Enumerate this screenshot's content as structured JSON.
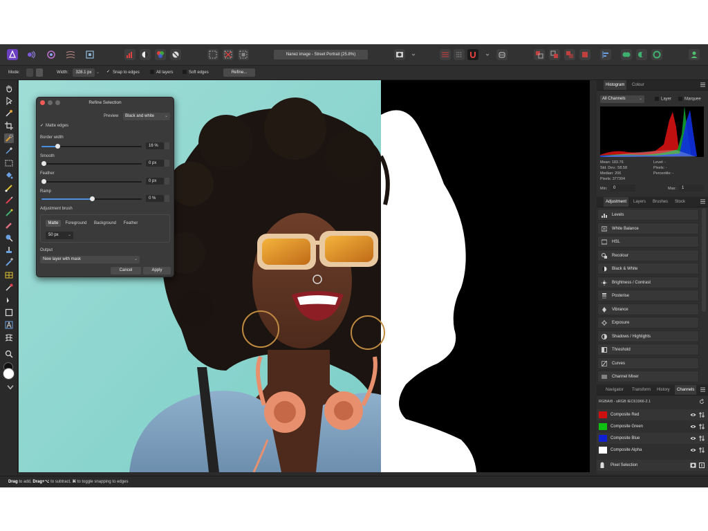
{
  "toolbar": {
    "document_title": "Nanez image - Street Portrait (25.8%)"
  },
  "context_bar": {
    "mode_label": "Mode:",
    "width_label": "Width:",
    "width_value": "328.1 px",
    "snap_to_edges": "Snap to edges",
    "all_layers": "All layers",
    "soft_edges": "Soft edges",
    "refine_button": "Refine..."
  },
  "dialog": {
    "title": "Refine Selection",
    "preview_label": "Preview",
    "preview_value": "Black and white",
    "matte_edges": "Matte edges",
    "border_width_label": "Border width",
    "border_width_value": "16 %",
    "border_width_fraction": 0.16,
    "smooth_label": "Smooth",
    "smooth_value": "0 px",
    "smooth_fraction": 0,
    "feather_label": "Feather",
    "feather_value": "0 px",
    "feather_fraction": 0,
    "ramp_label": "Ramp",
    "ramp_value": "0 %",
    "ramp_fraction": 0.5,
    "adjustment_brush_label": "Adjustment brush",
    "brush_modes": [
      "Matte",
      "Foreground",
      "Background",
      "Feather"
    ],
    "brush_size": "50 px",
    "output_label": "Output",
    "output_value": "New layer with mask",
    "cancel": "Cancel",
    "apply": "Apply"
  },
  "histogram_panel": {
    "tabs": [
      "Histogram",
      "Colour"
    ],
    "channels_select": "All Channels",
    "layer_label": "Layer",
    "marquee_label": "Marquee",
    "stats_left": [
      "Mean: 183.76",
      "Std. Dev.: 58.58",
      "Median: 206",
      "Pixels: 377304"
    ],
    "stats_right": [
      "Level: -",
      "Pixels: -",
      "Percentile: -"
    ],
    "min_label": "Min:",
    "min_value": "0",
    "max_label": "Max:",
    "max_value": "1"
  },
  "adjustment_panel": {
    "tabs": [
      "Adjustment",
      "Layers",
      "Brushes",
      "Stock"
    ],
    "items": [
      "Levels",
      "White Balance",
      "HSL",
      "Recolour",
      "Black & White",
      "Brightness / Contrast",
      "Posterise",
      "Vibrance",
      "Exposure",
      "Shadows / Highlights",
      "Threshold",
      "Curves",
      "Channel Mixer"
    ]
  },
  "channels_panel": {
    "tabs": [
      "Navigator",
      "Transform",
      "History",
      "Channels"
    ],
    "profile": "RGBA/8 - sRGB IEC61966-2.1",
    "channels": [
      {
        "label": "Composite Red",
        "color": "#d01010"
      },
      {
        "label": "Composite Green",
        "color": "#10c010"
      },
      {
        "label": "Composite Blue",
        "color": "#1020d0"
      },
      {
        "label": "Composite Alpha",
        "color": "#ffffff"
      }
    ],
    "pixel_selection": "Pixel Selection"
  },
  "status_bar": {
    "drag": "Drag",
    "to_add": " to add, ",
    "drag_alt": "Drag+⌥",
    "to_subtract": " to subtract, ",
    "cmd": "⌘",
    "toggle": " to toggle snapping to edges"
  }
}
